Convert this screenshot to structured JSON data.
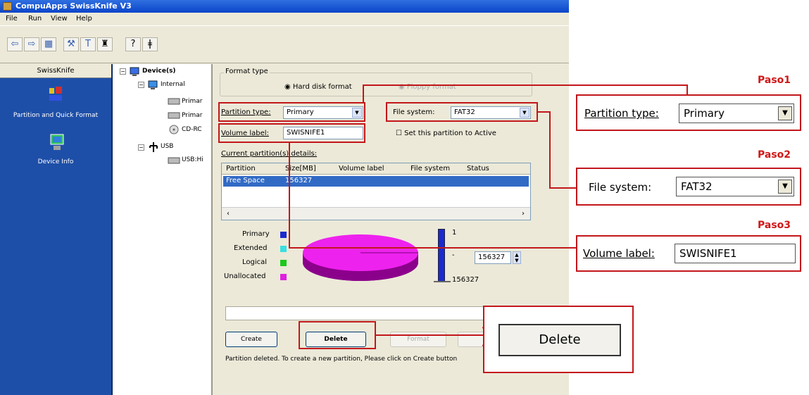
{
  "window": {
    "title": "CompuApps SwissKnife V3"
  },
  "menu": [
    "File",
    "Run",
    "View",
    "Help"
  ],
  "toolbar": {
    "icons": [
      "back-icon",
      "forward-icon",
      "grid-icon",
      "tools-icon",
      "format-icon",
      "trophy-icon",
      "help-icon",
      "info-icon"
    ]
  },
  "leftpane": {
    "header": "SwissKnife",
    "items": [
      {
        "label": "Partition and Quick Format",
        "icon": "partition-icon"
      },
      {
        "label": "Device Info",
        "icon": "device-info-icon"
      }
    ]
  },
  "tree": {
    "root": "Device(s)",
    "internal": "Internal",
    "children_internal": [
      "Primar",
      "Primar",
      "CD-RC"
    ],
    "usb": "USB",
    "children_usb": [
      "USB:Hi"
    ]
  },
  "form": {
    "format_type_label": "Format type",
    "hard_disk_format": "Hard disk format",
    "floppy_format": "Floppy format",
    "partition_type_label": "Partition type:",
    "partition_type_value": "Primary",
    "file_system_label": "File system:",
    "file_system_value": "FAT32",
    "volume_label_label": "Volume label:",
    "volume_label_value": "SWISNIFE1",
    "set_active_label": "Set this partition to Active",
    "details_label": "Current partition(s) details:",
    "columns": [
      "Partition",
      "Size[MB]",
      "Volume label",
      "File system",
      "Status"
    ],
    "row": [
      "Free Space",
      "156327",
      "",
      "",
      ""
    ],
    "legend": [
      {
        "label": "Primary",
        "color": "#1a2ad0"
      },
      {
        "label": "Extended",
        "color": "#38e0e0"
      },
      {
        "label": "Logical",
        "color": "#1cc81c"
      },
      {
        "label": "Unallocated",
        "color": "#e020e0"
      }
    ],
    "slider_top": "1",
    "slider_mid": "-",
    "slider_bottom": "156327",
    "spinner_value": "156327",
    "buttons": {
      "create": "Create",
      "delete": "Delete",
      "format": "Format"
    },
    "status_text": "Partition deleted. To create a new partition, Please click on Create button"
  },
  "callouts": {
    "paso1": "Paso1",
    "paso2": "Paso2",
    "paso3": "Paso3",
    "partition_type_label": "Partition type:",
    "partition_type_value": "Primary",
    "file_system_label": "File system:",
    "file_system_value": "FAT32",
    "volume_label_label": "Volume label:",
    "volume_label_value": "SWISNIFE1",
    "delete_label": "Delete"
  }
}
